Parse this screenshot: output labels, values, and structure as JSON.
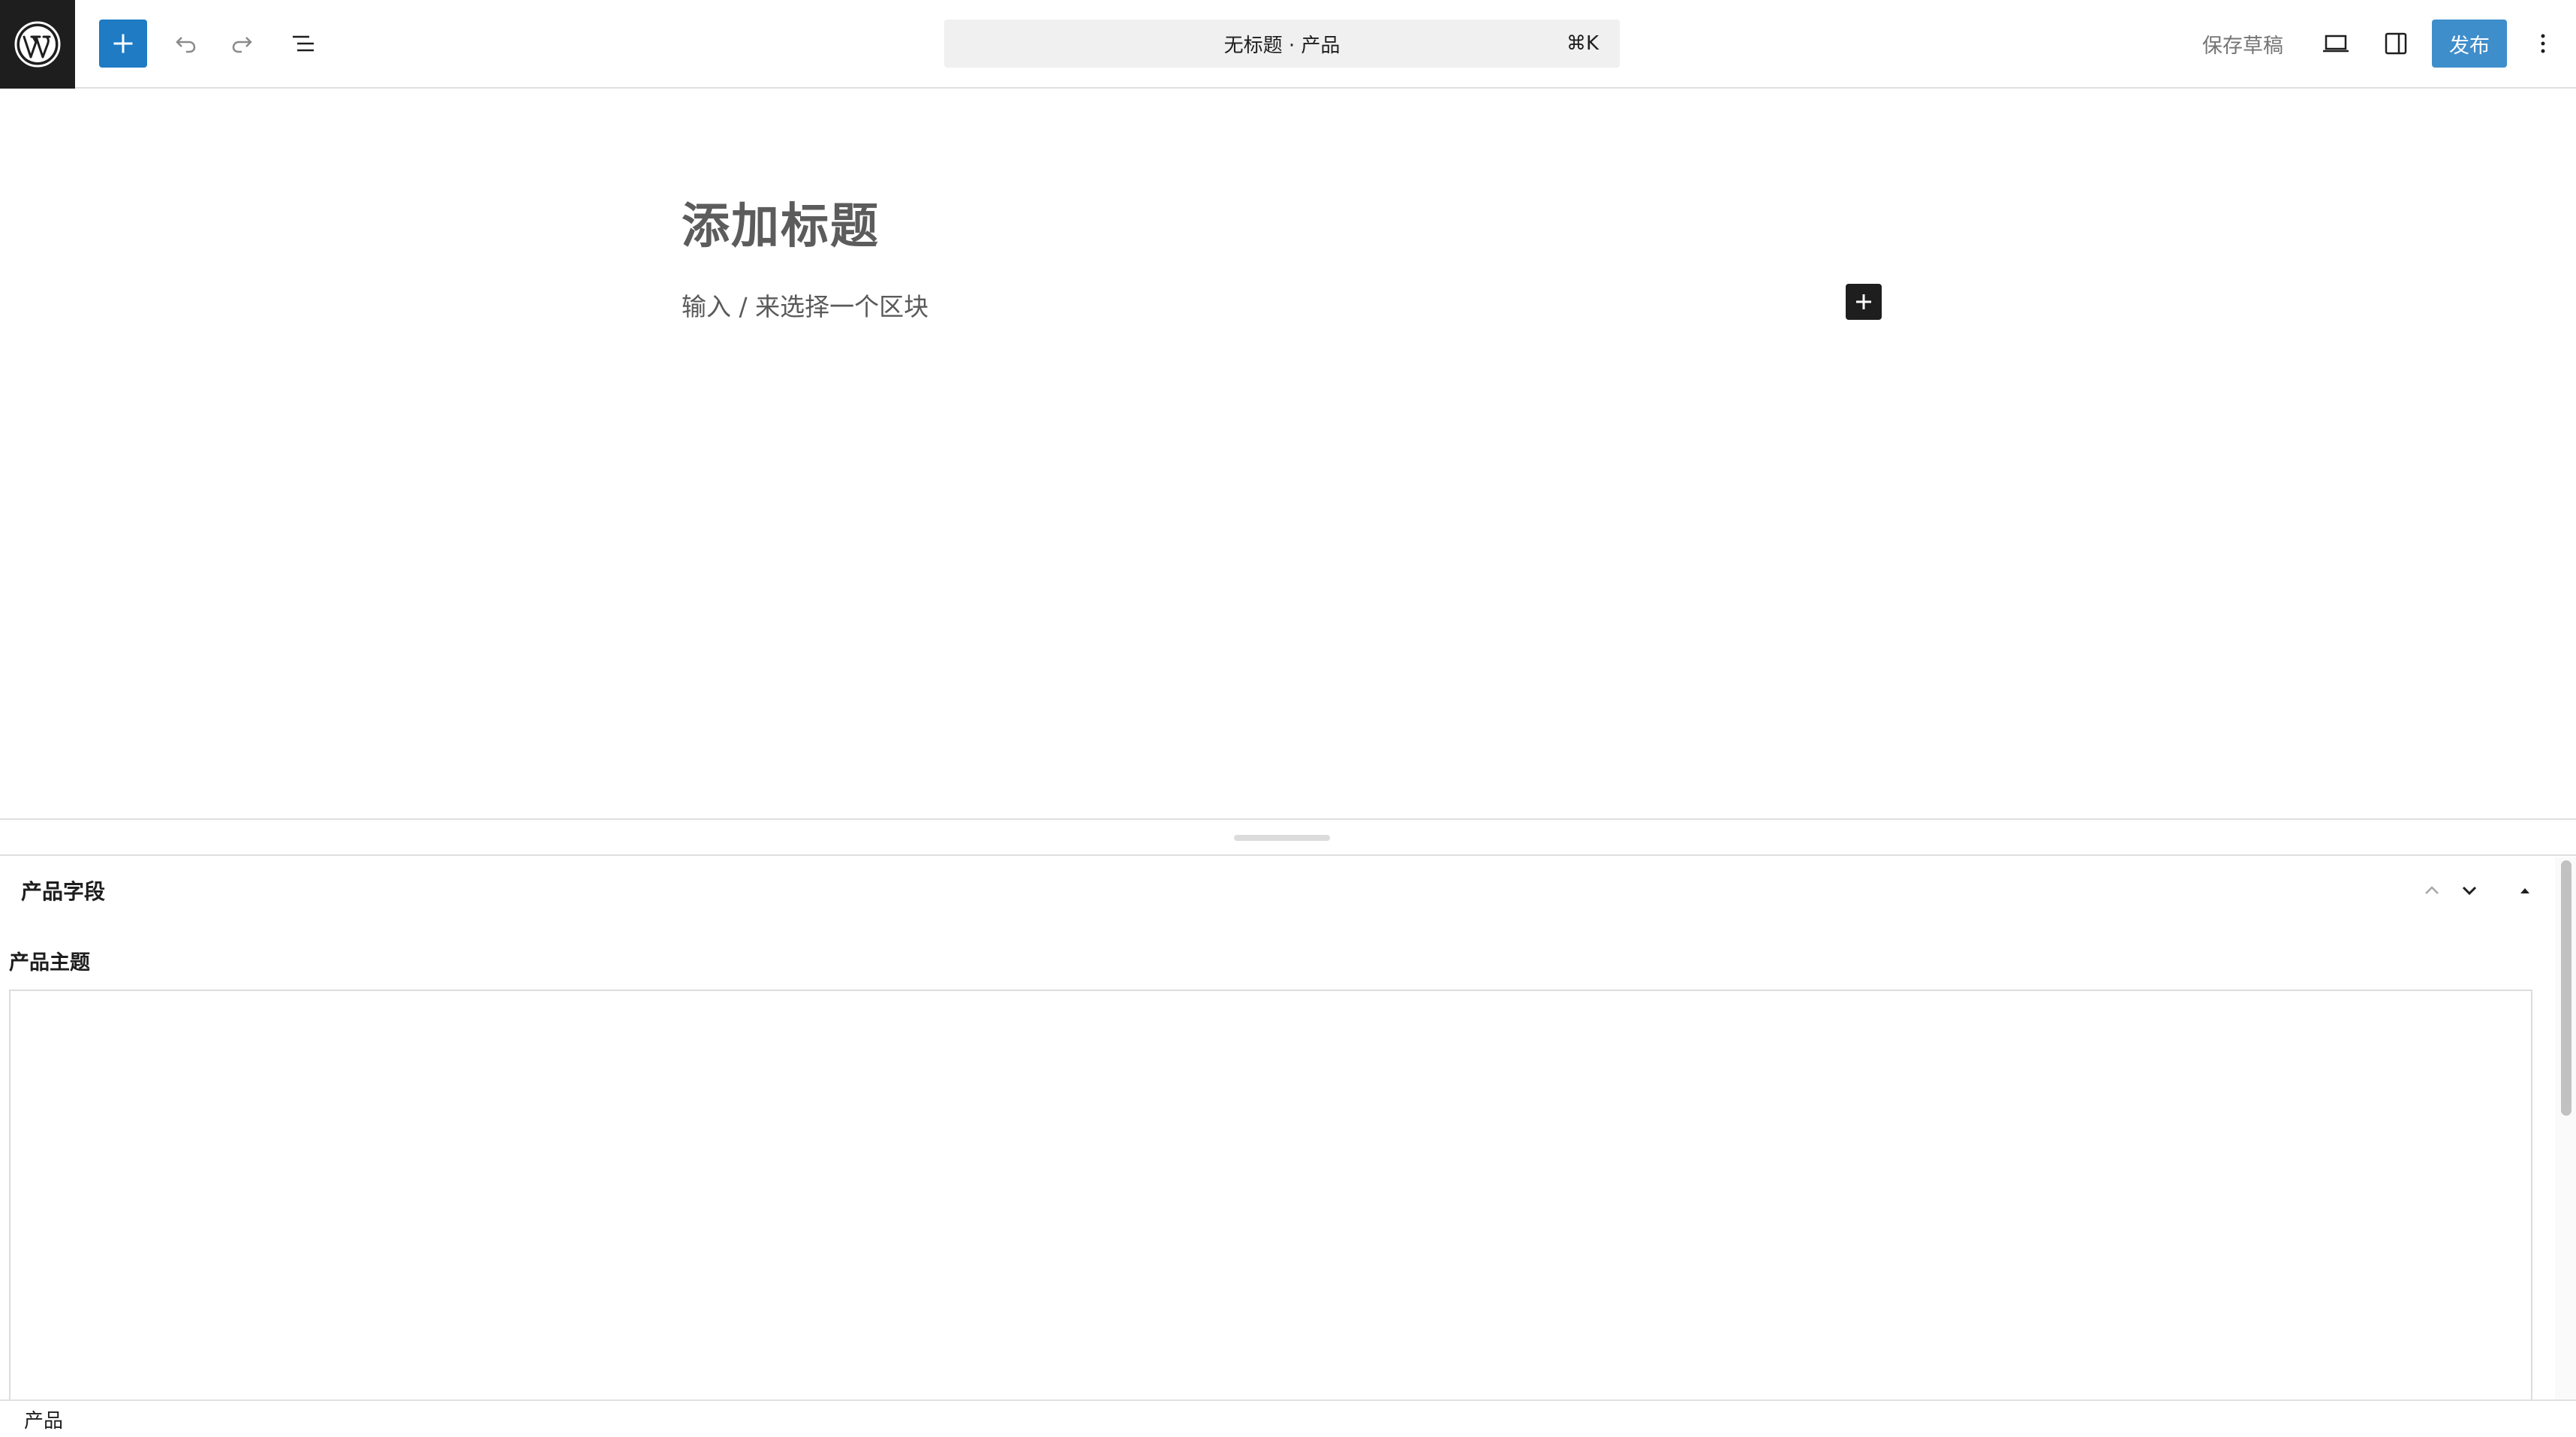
{
  "toolbar": {
    "logo_icon": "wordpress-icon",
    "inserter_icon": "plus-icon",
    "undo_icon": "undo-icon",
    "redo_icon": "redo-icon",
    "list_view_icon": "list-view-icon",
    "command_bar": {
      "title": "无标题 · 产品",
      "shortcut": "⌘K"
    },
    "save_draft_label": "保存草稿",
    "view_icon": "desktop-view-icon",
    "settings_icon": "sidebar-icon",
    "publish_label": "发布",
    "options_icon": "kebab-menu-icon",
    "accent_color": "#1e7bc4"
  },
  "editor": {
    "title_placeholder": "添加标题",
    "block_placeholder": "输入 / 来选择一个区块",
    "block_inserter_icon": "plus-icon"
  },
  "metabox": {
    "title": "产品字段",
    "move_up_icon": "chevron-up-icon",
    "move_down_icon": "chevron-down-icon",
    "toggle_icon": "caret-up-icon",
    "field": {
      "label": "产品主题",
      "value": ""
    }
  },
  "footer": {
    "breadcrumb": [
      "产品"
    ]
  }
}
